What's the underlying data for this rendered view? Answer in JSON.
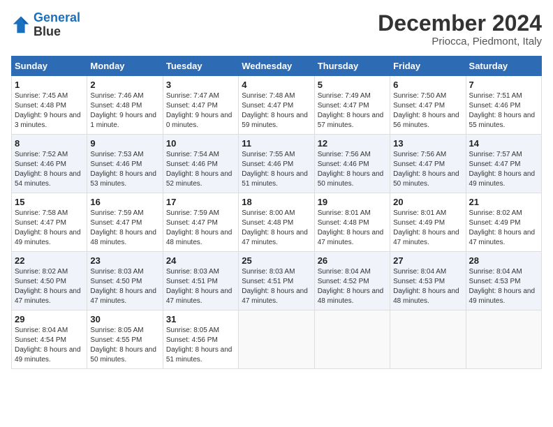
{
  "logo": {
    "line1": "General",
    "line2": "Blue"
  },
  "title": "December 2024",
  "subtitle": "Priocca, Piedmont, Italy",
  "days_header": [
    "Sunday",
    "Monday",
    "Tuesday",
    "Wednesday",
    "Thursday",
    "Friday",
    "Saturday"
  ],
  "weeks": [
    [
      {
        "num": "1",
        "rise": "7:45 AM",
        "set": "4:48 PM",
        "daylight": "9 hours and 3 minutes."
      },
      {
        "num": "2",
        "rise": "7:46 AM",
        "set": "4:48 PM",
        "daylight": "9 hours and 1 minute."
      },
      {
        "num": "3",
        "rise": "7:47 AM",
        "set": "4:47 PM",
        "daylight": "9 hours and 0 minutes."
      },
      {
        "num": "4",
        "rise": "7:48 AM",
        "set": "4:47 PM",
        "daylight": "8 hours and 59 minutes."
      },
      {
        "num": "5",
        "rise": "7:49 AM",
        "set": "4:47 PM",
        "daylight": "8 hours and 57 minutes."
      },
      {
        "num": "6",
        "rise": "7:50 AM",
        "set": "4:47 PM",
        "daylight": "8 hours and 56 minutes."
      },
      {
        "num": "7",
        "rise": "7:51 AM",
        "set": "4:46 PM",
        "daylight": "8 hours and 55 minutes."
      }
    ],
    [
      {
        "num": "8",
        "rise": "7:52 AM",
        "set": "4:46 PM",
        "daylight": "8 hours and 54 minutes."
      },
      {
        "num": "9",
        "rise": "7:53 AM",
        "set": "4:46 PM",
        "daylight": "8 hours and 53 minutes."
      },
      {
        "num": "10",
        "rise": "7:54 AM",
        "set": "4:46 PM",
        "daylight": "8 hours and 52 minutes."
      },
      {
        "num": "11",
        "rise": "7:55 AM",
        "set": "4:46 PM",
        "daylight": "8 hours and 51 minutes."
      },
      {
        "num": "12",
        "rise": "7:56 AM",
        "set": "4:46 PM",
        "daylight": "8 hours and 50 minutes."
      },
      {
        "num": "13",
        "rise": "7:56 AM",
        "set": "4:47 PM",
        "daylight": "8 hours and 50 minutes."
      },
      {
        "num": "14",
        "rise": "7:57 AM",
        "set": "4:47 PM",
        "daylight": "8 hours and 49 minutes."
      }
    ],
    [
      {
        "num": "15",
        "rise": "7:58 AM",
        "set": "4:47 PM",
        "daylight": "8 hours and 49 minutes."
      },
      {
        "num": "16",
        "rise": "7:59 AM",
        "set": "4:47 PM",
        "daylight": "8 hours and 48 minutes."
      },
      {
        "num": "17",
        "rise": "7:59 AM",
        "set": "4:47 PM",
        "daylight": "8 hours and 48 minutes."
      },
      {
        "num": "18",
        "rise": "8:00 AM",
        "set": "4:48 PM",
        "daylight": "8 hours and 47 minutes."
      },
      {
        "num": "19",
        "rise": "8:01 AM",
        "set": "4:48 PM",
        "daylight": "8 hours and 47 minutes."
      },
      {
        "num": "20",
        "rise": "8:01 AM",
        "set": "4:49 PM",
        "daylight": "8 hours and 47 minutes."
      },
      {
        "num": "21",
        "rise": "8:02 AM",
        "set": "4:49 PM",
        "daylight": "8 hours and 47 minutes."
      }
    ],
    [
      {
        "num": "22",
        "rise": "8:02 AM",
        "set": "4:50 PM",
        "daylight": "8 hours and 47 minutes."
      },
      {
        "num": "23",
        "rise": "8:03 AM",
        "set": "4:50 PM",
        "daylight": "8 hours and 47 minutes."
      },
      {
        "num": "24",
        "rise": "8:03 AM",
        "set": "4:51 PM",
        "daylight": "8 hours and 47 minutes."
      },
      {
        "num": "25",
        "rise": "8:03 AM",
        "set": "4:51 PM",
        "daylight": "8 hours and 47 minutes."
      },
      {
        "num": "26",
        "rise": "8:04 AM",
        "set": "4:52 PM",
        "daylight": "8 hours and 48 minutes."
      },
      {
        "num": "27",
        "rise": "8:04 AM",
        "set": "4:53 PM",
        "daylight": "8 hours and 48 minutes."
      },
      {
        "num": "28",
        "rise": "8:04 AM",
        "set": "4:53 PM",
        "daylight": "8 hours and 49 minutes."
      }
    ],
    [
      {
        "num": "29",
        "rise": "8:04 AM",
        "set": "4:54 PM",
        "daylight": "8 hours and 49 minutes."
      },
      {
        "num": "30",
        "rise": "8:05 AM",
        "set": "4:55 PM",
        "daylight": "8 hours and 50 minutes."
      },
      {
        "num": "31",
        "rise": "8:05 AM",
        "set": "4:56 PM",
        "daylight": "8 hours and 51 minutes."
      },
      null,
      null,
      null,
      null
    ]
  ]
}
